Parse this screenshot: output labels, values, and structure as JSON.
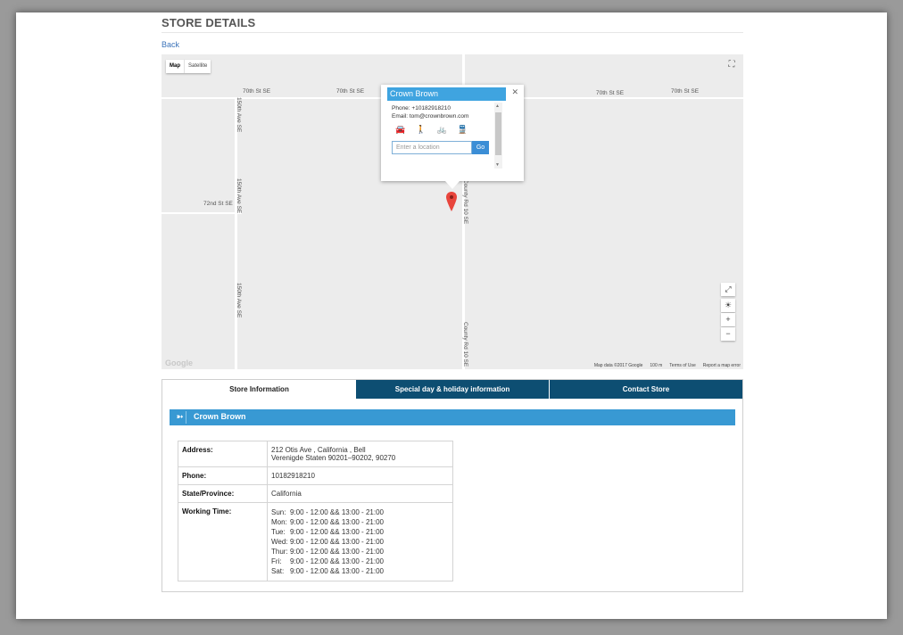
{
  "page": {
    "title": "STORE DETAILS",
    "back_label": "Back"
  },
  "map": {
    "map_type_options": [
      "Map",
      "Satellite"
    ],
    "streets": {
      "s70_left": "70th St SE",
      "s70_mid": "70th St SE",
      "s70_right1": "70th St SE",
      "s70_right2": "70th St SE",
      "ave150_top": "150th Ave SE",
      "ave150_mid": "150th Ave SE",
      "ave150_bottom": "150th Ave SE",
      "s72": "72nd St SE",
      "county_top": "County Rd 10 SE",
      "county_bottom": "County Rd 10 SE"
    },
    "zoom_in": "+",
    "zoom_out": "−",
    "google_logo": "Google",
    "attribution": {
      "map_data": "Map data ©2017 Google",
      "scale": "100 m",
      "terms": "Terms of Use",
      "report": "Report a map error"
    },
    "info_window": {
      "title": "Crown Brown",
      "phone": "Phone: +10182918210",
      "email": "Email: tom@crownbrown.com",
      "location_placeholder": "Enter a location",
      "go_label": "Go"
    },
    "colors": {
      "marker": "#e8453c",
      "info_title_bg": "#3fa4e0"
    }
  },
  "tabs": [
    {
      "label": "Store Information",
      "active": true
    },
    {
      "label": "Special day & holiday information",
      "active": false
    },
    {
      "label": "Contact Store",
      "active": false
    }
  ],
  "store": {
    "name": "Crown Brown",
    "rows": {
      "address_label": "Address:",
      "address_line1": "212 Otis Ave , California , Bell",
      "address_line2": "Verenigde Staten 90201–90202, 90270",
      "phone_label": "Phone:",
      "phone_value": "10182918210",
      "state_label": "State/Province:",
      "state_value": "California",
      "working_label": "Working Time:"
    },
    "working_time": [
      {
        "day": "Sun:",
        "hours": "9:00 - 12:00 && 13:00 - 21:00"
      },
      {
        "day": "Mon:",
        "hours": "9:00 - 12:00 && 13:00 - 21:00"
      },
      {
        "day": "Tue:",
        "hours": "9:00 - 12:00 && 13:00 - 21:00"
      },
      {
        "day": "Wed:",
        "hours": "9:00 - 12:00 && 13:00 - 21:00"
      },
      {
        "day": "Thur:",
        "hours": "9:00 - 12:00 && 13:00 - 21:00"
      },
      {
        "day": "Fri:",
        "hours": "9:00 - 12:00 && 13:00 - 21:00"
      },
      {
        "day": "Sat:",
        "hours": "9:00 - 12:00 && 13:00 - 21:00"
      }
    ]
  },
  "colors": {
    "tab_inactive_bg": "#0d4e72",
    "store_bar_bg": "#3899d3",
    "link": "#3b73b9"
  }
}
